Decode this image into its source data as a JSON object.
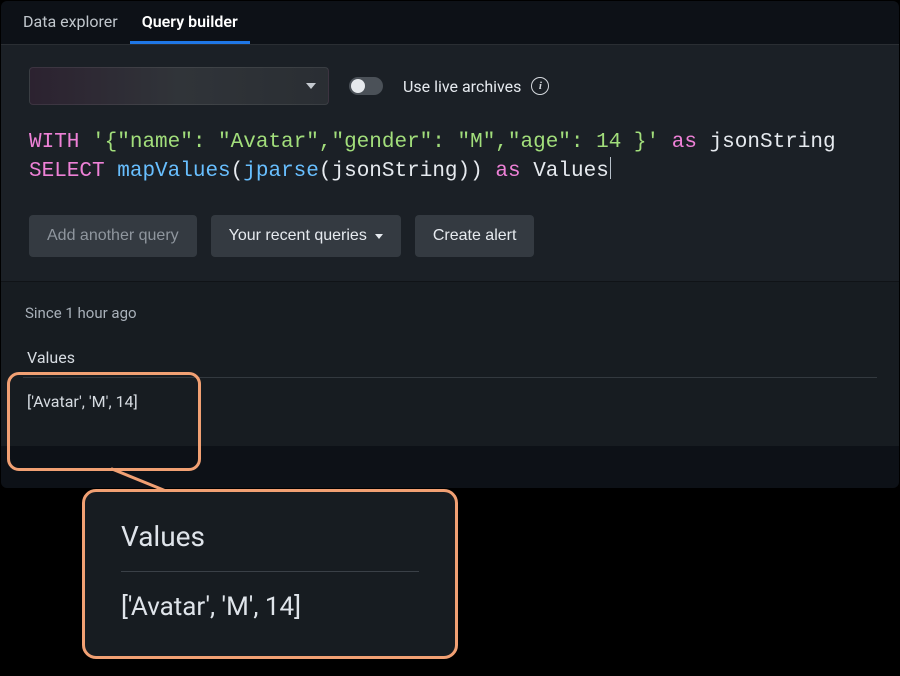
{
  "tabs": {
    "data_explorer": "Data explorer",
    "query_builder": "Query builder"
  },
  "toolbar": {
    "live_archives_label": "Use live archives"
  },
  "query": {
    "tokens": {
      "with": "WITH",
      "json_string_literal": "'{\"name\": \"Avatar\",\"gender\": \"M\",\"age\": 14 }'",
      "as1": "as",
      "ident_jsonString": "jsonString",
      "select": "SELECT",
      "fn_mapValues": "mapValues",
      "fn_jparse": "jparse",
      "as2": "as",
      "ident_values": "Values"
    }
  },
  "buttons": {
    "add_another_query": "Add another query",
    "recent_queries": "Your recent queries",
    "create_alert": "Create alert"
  },
  "results": {
    "since_label": "Since 1 hour ago",
    "column_header": "Values",
    "row_value": "['Avatar', 'M', 14]"
  },
  "zoom": {
    "header": "Values",
    "value": "['Avatar', 'M', 14]"
  }
}
